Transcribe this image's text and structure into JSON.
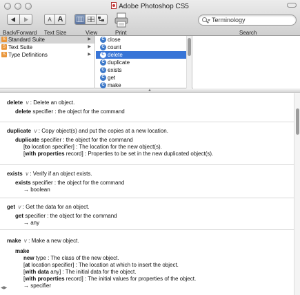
{
  "window": {
    "title": "Adobe Photoshop CS5"
  },
  "toolbar": {
    "back_forward_label": "Back/Forward",
    "text_size_label": "Text Size",
    "view_label": "View",
    "print_label": "Print",
    "search_label": "Search",
    "text_size_small": "A",
    "text_size_large": "A"
  },
  "search": {
    "value": "Terminology"
  },
  "suites": [
    {
      "label": "Standard Suite",
      "badge": "S",
      "selected": true
    },
    {
      "label": "Text Suite",
      "badge": "S",
      "selected": false
    },
    {
      "label": "Type Definitions",
      "badge": "S",
      "selected": false
    }
  ],
  "commands": [
    {
      "label": "close",
      "badge": "C",
      "selected": false
    },
    {
      "label": "count",
      "badge": "C",
      "selected": false
    },
    {
      "label": "delete",
      "badge": "C",
      "selected": true
    },
    {
      "label": "duplicate",
      "badge": "C",
      "selected": false
    },
    {
      "label": "exists",
      "badge": "C",
      "selected": false
    },
    {
      "label": "get",
      "badge": "C",
      "selected": false
    },
    {
      "label": "make",
      "badge": "C",
      "selected": false
    }
  ],
  "doc": {
    "delete": {
      "name": "delete",
      "kind": "v",
      "summary": " : Delete an object.",
      "param_name": "delete",
      "param_text": " specifier : the object for the command"
    },
    "duplicate": {
      "name": "duplicate",
      "kind": "v",
      "summary": " : Copy object(s) and put the copies at a new location.",
      "param_name": "duplicate",
      "param_text": " specifier : the object for the command",
      "opt1_pre": "[",
      "opt1_key": "to",
      "opt1_text": " location specifier] : The location for the new object(s).",
      "opt2_pre": "[",
      "opt2_key": "with properties",
      "opt2_text": " record] : Properties to be set in the new duplicated object(s)."
    },
    "exists": {
      "name": "exists",
      "kind": "v",
      "summary": " : Verify if an object exists.",
      "param_name": "exists",
      "param_text": " specifier : the object for the command",
      "result": "→ boolean"
    },
    "get": {
      "name": "get",
      "kind": "v",
      "summary": " : Get the data for an object.",
      "param_name": "get",
      "param_text": " specifier : the object for the command",
      "result": "→ any"
    },
    "make": {
      "name": "make",
      "kind": "v",
      "summary": " : Make a new object.",
      "param_name": "make",
      "p1_key": "new",
      "p1_text": " type : The class of the new object.",
      "p2_pre": "[",
      "p2_key": "at",
      "p2_text": " location specifier] : The location at which to insert the object.",
      "p3_pre": "[",
      "p3_key": "with data",
      "p3_text": " any] : The initial data for the object.",
      "p4_pre": "[",
      "p4_key": "with properties",
      "p4_text": " record] : The initial values for properties of the object.",
      "result": "→ specifier"
    }
  }
}
